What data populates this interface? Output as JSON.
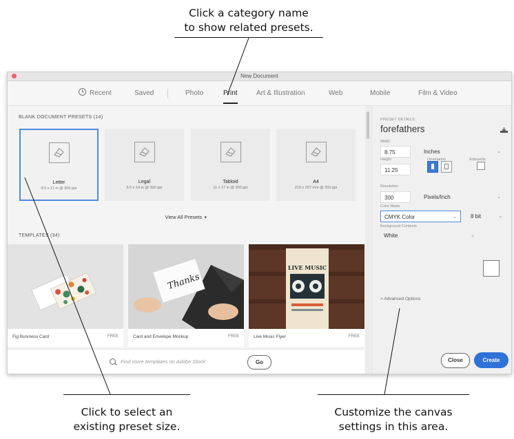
{
  "callouts": {
    "top": [
      "Click a category name",
      "to show related presets."
    ],
    "bottom_left": [
      "Click to select an",
      "existing preset size."
    ],
    "bottom_right": [
      "Customize the canvas",
      "settings in this area."
    ]
  },
  "window": {
    "title": "New Document"
  },
  "tabs": [
    {
      "label": "Recent",
      "active": false
    },
    {
      "label": "Saved",
      "active": false
    },
    {
      "label": "Photo",
      "active": false
    },
    {
      "label": "Print",
      "active": true
    },
    {
      "label": "Art & Illustration",
      "active": false
    },
    {
      "label": "Web",
      "active": false
    },
    {
      "label": "Mobile",
      "active": false
    },
    {
      "label": "Film & Video",
      "active": false
    }
  ],
  "blank_presets": {
    "heading": "BLANK DOCUMENT PRESETS (14)",
    "items": [
      {
        "name": "Letter",
        "dims": "8.5 x 11 in @ 300 ppi",
        "selected": true
      },
      {
        "name": "Legal",
        "dims": "8.5 x 14 in @ 300 ppi",
        "selected": false
      },
      {
        "name": "Tabloid",
        "dims": "11 x 17 in @ 300 ppi",
        "selected": false
      },
      {
        "name": "A4",
        "dims": "210 x 297 mm @ 300 ppi",
        "selected": false
      }
    ],
    "view_all": "View All Presets",
    "view_all_icon": "+"
  },
  "templates": {
    "heading": "TEMPLATES (34)",
    "items": [
      {
        "name": "Fig Business Card",
        "badge": "FREE"
      },
      {
        "name": "Card and Envelope Mockup",
        "badge": "FREE"
      },
      {
        "name": "Live Music Flyer",
        "badge": "FREE"
      }
    ],
    "thumb_texts": {
      "card": "Thanks",
      "flyer": "LIVE MUSIC"
    }
  },
  "search": {
    "placeholder": "Find more templates on Adobe Stock",
    "go_label": "Go"
  },
  "preset_details": {
    "heading": "PRESET DETAILS",
    "name": "forefathers",
    "width_label": "Width",
    "width_value": "8.75",
    "width_unit": "Inches",
    "height_label": "Height",
    "height_value": "11.25",
    "orientation_label": "Orientation",
    "artboards_label": "Artboards",
    "resolution_label": "Resolution",
    "resolution_value": "300",
    "resolution_unit": "Pixels/Inch",
    "color_mode_label": "Color Mode",
    "color_mode_value": "CMYK Color",
    "bit_depth": "8 bit",
    "background_label": "Background Contents",
    "background_value": "White",
    "advanced": "> Advanced Options",
    "close_label": "Close",
    "create_label": "Create"
  },
  "colors": {
    "accent": "#2e71d8",
    "selection": "#4e8ae0"
  }
}
